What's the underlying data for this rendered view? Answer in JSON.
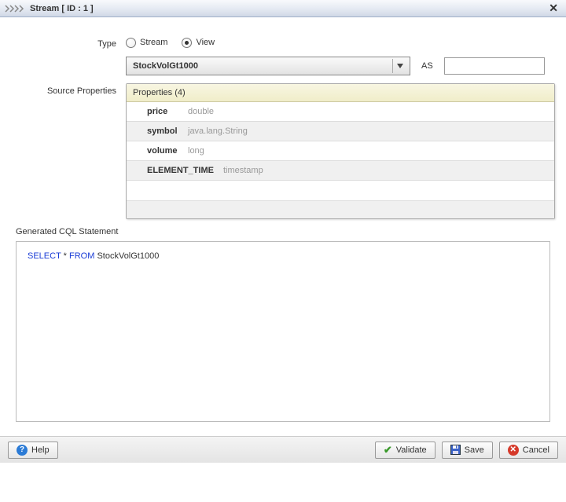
{
  "title": "Stream [ ID : 1 ]",
  "type": {
    "label": "Type",
    "stream": "Stream",
    "view": "View",
    "selected": "view"
  },
  "source_select": {
    "value": "StockVolGt1000",
    "as_label": "AS",
    "as_value": ""
  },
  "props": {
    "section_label": "Source Properties",
    "header": "Properties (4)",
    "items": [
      {
        "name": "price",
        "type": "double"
      },
      {
        "name": "symbol",
        "type": "java.lang.String"
      },
      {
        "name": "volume",
        "type": "long"
      },
      {
        "name": "ELEMENT_TIME",
        "type": "timestamp"
      }
    ]
  },
  "cql": {
    "label": "Generated CQL Statement",
    "kw_select": "SELECT",
    "star": "*",
    "kw_from": "FROM",
    "source": "StockVolGt1000"
  },
  "buttons": {
    "help": "Help",
    "validate": "Validate",
    "save": "Save",
    "cancel": "Cancel"
  }
}
